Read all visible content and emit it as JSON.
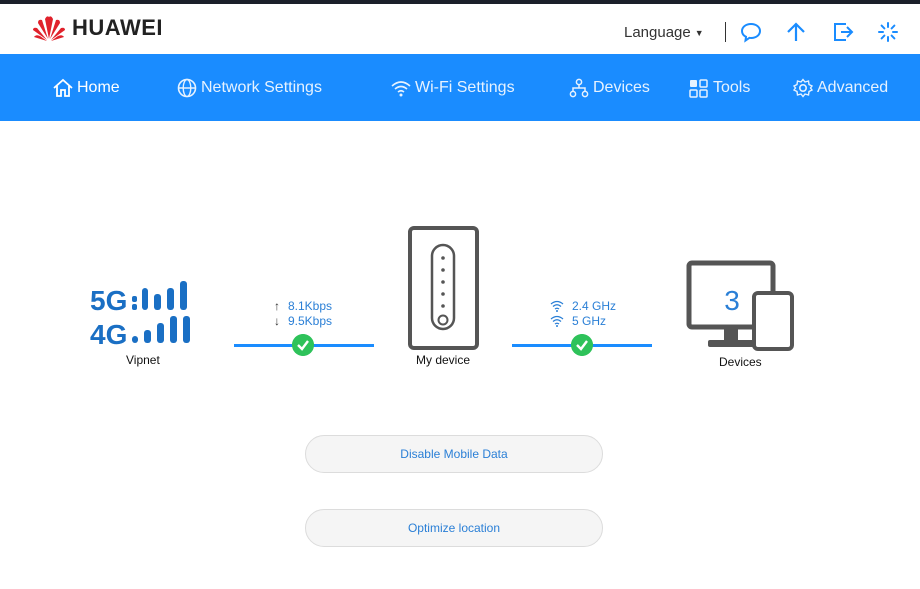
{
  "header": {
    "brand": "HUAWEI",
    "language_label": "Language",
    "icons": [
      "chat-icon",
      "upload-icon",
      "logout-icon",
      "loading-icon"
    ]
  },
  "nav": {
    "items": [
      {
        "label": "Home",
        "icon": "home-icon",
        "active": true
      },
      {
        "label": "Network Settings",
        "icon": "globe-icon"
      },
      {
        "label": "Wi-Fi Settings",
        "icon": "wifi-icon"
      },
      {
        "label": "Devices",
        "icon": "devices-tree-icon"
      },
      {
        "label": "Tools",
        "icon": "tools-grid-icon"
      },
      {
        "label": "Advanced",
        "icon": "gear-icon"
      }
    ]
  },
  "status": {
    "network": {
      "label_5g": "5G",
      "label_4g": "4G",
      "operator": "Vipnet"
    },
    "upload_rate": "8.1Kbps",
    "download_rate": "9.5Kbps",
    "device_label": "My device",
    "wifi_24": "2.4 GHz",
    "wifi_5": "5 GHz",
    "devices_count": "3",
    "devices_label": "Devices"
  },
  "actions": {
    "disable_mobile_data": "Disable Mobile Data",
    "optimize_location": "Optimize location"
  },
  "colors": {
    "accent": "#1a8cff",
    "brand_red": "#e0212b",
    "ok_green": "#2ec25a",
    "link_blue": "#2a7fd6"
  }
}
